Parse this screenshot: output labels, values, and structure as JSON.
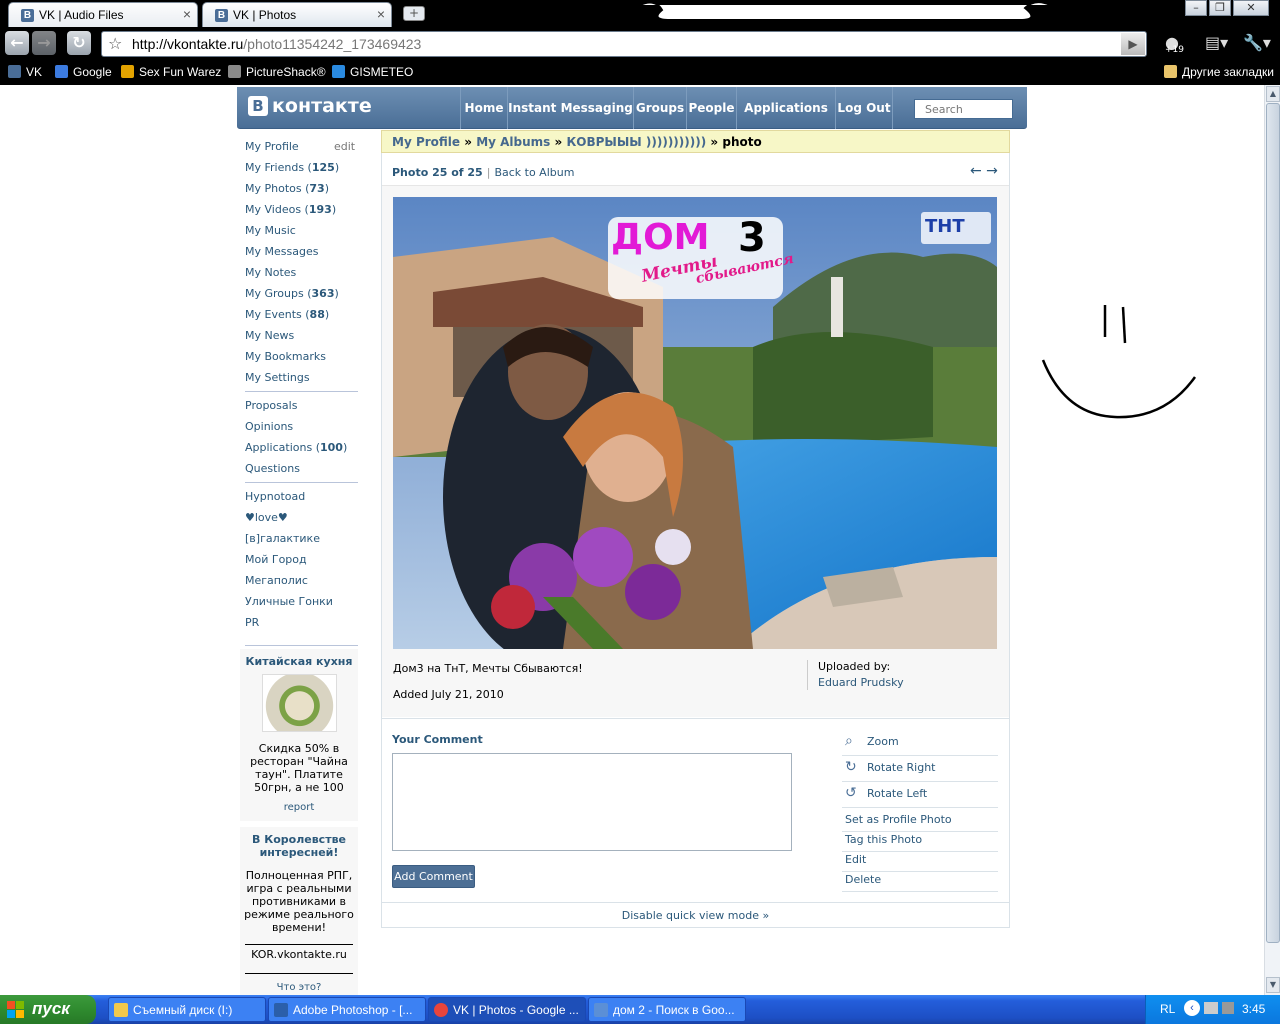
{
  "browser": {
    "tabs": [
      {
        "label": "VK | Audio Files"
      },
      {
        "label": "VK | Photos"
      }
    ],
    "url_host": "http://vkontakte.ru",
    "url_path": "/photo11354242_173469423",
    "ext_badge": "+19",
    "bookmarks": [
      {
        "label": "VK",
        "color": "#4a6d97"
      },
      {
        "label": "Google",
        "color": "#3c7be0"
      },
      {
        "label": "Sex Fun Warez",
        "color": "#e3a300"
      },
      {
        "label": "PictureShack®",
        "color": "#8a8a8a"
      },
      {
        "label": "GISMETEO",
        "color": "#2a8ae0"
      }
    ],
    "other_bookmarks": "Другие закладки"
  },
  "vk": {
    "logo_letter": "B",
    "logo_text": "контакте",
    "nav": [
      "Home",
      "Instant Messaging",
      "Groups",
      "People",
      "Applications",
      "Log Out"
    ],
    "search_placeholder": "Search",
    "menu_edit": "edit",
    "menu": [
      {
        "label": "My Profile",
        "count": ""
      },
      {
        "label": "My Friends",
        "count": "125"
      },
      {
        "label": "My Photos",
        "count": "73"
      },
      {
        "label": "My Videos",
        "count": "193"
      },
      {
        "label": "My Music",
        "count": ""
      },
      {
        "label": "My Messages",
        "count": ""
      },
      {
        "label": "My Notes",
        "count": ""
      },
      {
        "label": "My Groups",
        "count": "363"
      },
      {
        "label": "My Events",
        "count": "88"
      },
      {
        "label": "My News",
        "count": ""
      },
      {
        "label": "My Bookmarks",
        "count": ""
      },
      {
        "label": "My Settings",
        "count": ""
      }
    ],
    "menu2": [
      {
        "label": "Proposals",
        "count": ""
      },
      {
        "label": "Opinions",
        "count": ""
      },
      {
        "label": "Applications",
        "count": "100"
      },
      {
        "label": "Questions",
        "count": ""
      }
    ],
    "menu3": [
      "Hypnotoad",
      "♥love♥",
      "[в]галактике",
      "Мой Город",
      "Мегаполис",
      "Уличные Гонки",
      "PR"
    ],
    "promo1": {
      "title": "Китайская кухня",
      "text": "Скидка 50% в ресторан \"Чайна таун\". Платите 50грн, а не 100",
      "report": "report"
    },
    "promo2": {
      "title": "В Королевстве интересней!",
      "text": "Полноценная РПГ, игра с реальными противниками в режиме реального времени!",
      "link": "KOR.vkontakte.ru",
      "more": "Что это?"
    },
    "breadcrumb": {
      "profile": "My Profile",
      "albums": "My Albums",
      "album": "КОВРЫЫЫ )))))))))))",
      "current": "photo",
      "sep": "»"
    },
    "photo_num": "Photo 25 of 25",
    "back_to_album": "Back to Album",
    "arrows": "← →",
    "overlay_logo": "ДОМ",
    "overlay_num": "3",
    "overlay_sub1": "Мечты",
    "overlay_sub2": "сбываются",
    "overlay_tnt": "ТНТ",
    "description": "Дом3 на ТнТ, Мечты Сбываются!",
    "added": "Added July 21, 2010",
    "uploaded_label": "Uploaded by:",
    "uploader": "Eduard Prudsky",
    "comment_label": "Your Comment",
    "add_comment": "Add Comment",
    "actions": [
      "Zoom",
      "Rotate Right",
      "Rotate Left",
      "Set as Profile Photo",
      "Tag this Photo",
      "Edit",
      "Delete"
    ],
    "disable_quick": "Disable quick view mode »"
  },
  "taskbar": {
    "start": "пуск",
    "tasks": [
      {
        "label": "Съемный диск (I:)",
        "color": "#f2c94c"
      },
      {
        "label": "Adobe Photoshop - [...",
        "color": "#2b5faa"
      },
      {
        "label": "VK | Photos - Google ...",
        "color": "#e8453c"
      },
      {
        "label": "дом 2 - Поиск в Goo...",
        "color": "#5b8fd6"
      }
    ],
    "lang": "RL",
    "time": "3:45"
  }
}
